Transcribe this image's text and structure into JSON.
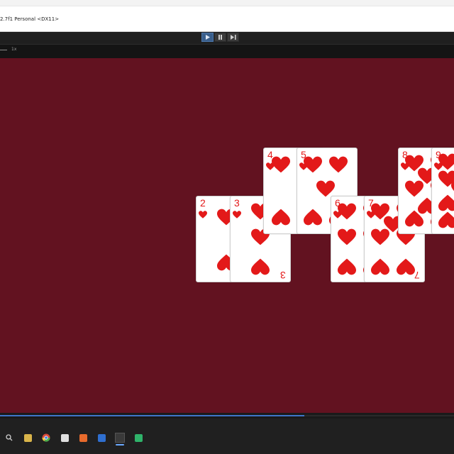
{
  "window": {
    "title": "2.7f1 Personal <DX11>"
  },
  "toolbar": {
    "play": "play-icon",
    "pause": "pause-icon",
    "step": "step-icon"
  },
  "gameview": {
    "scale_label": "1x"
  },
  "cards": [
    {
      "rank": "2",
      "suit": "hearts"
    },
    {
      "rank": "3",
      "suit": "hearts"
    },
    {
      "rank": "4",
      "suit": "hearts"
    },
    {
      "rank": "5",
      "suit": "hearts"
    },
    {
      "rank": "6",
      "suit": "hearts"
    },
    {
      "rank": "7",
      "suit": "hearts"
    },
    {
      "rank": "8",
      "suit": "hearts"
    },
    {
      "rank": "9",
      "suit": "hearts"
    }
  ],
  "colors": {
    "table": "#621220",
    "suit": "#e31919",
    "accent": "#3f74c9"
  },
  "progress": {
    "fraction": 0.67
  },
  "taskbar": {
    "icons": [
      "search-icon",
      "file-explorer-icon",
      "chrome-icon",
      "app-icon",
      "media-icon",
      "app-blue-icon",
      "unity-icon",
      "app-green-icon"
    ]
  }
}
